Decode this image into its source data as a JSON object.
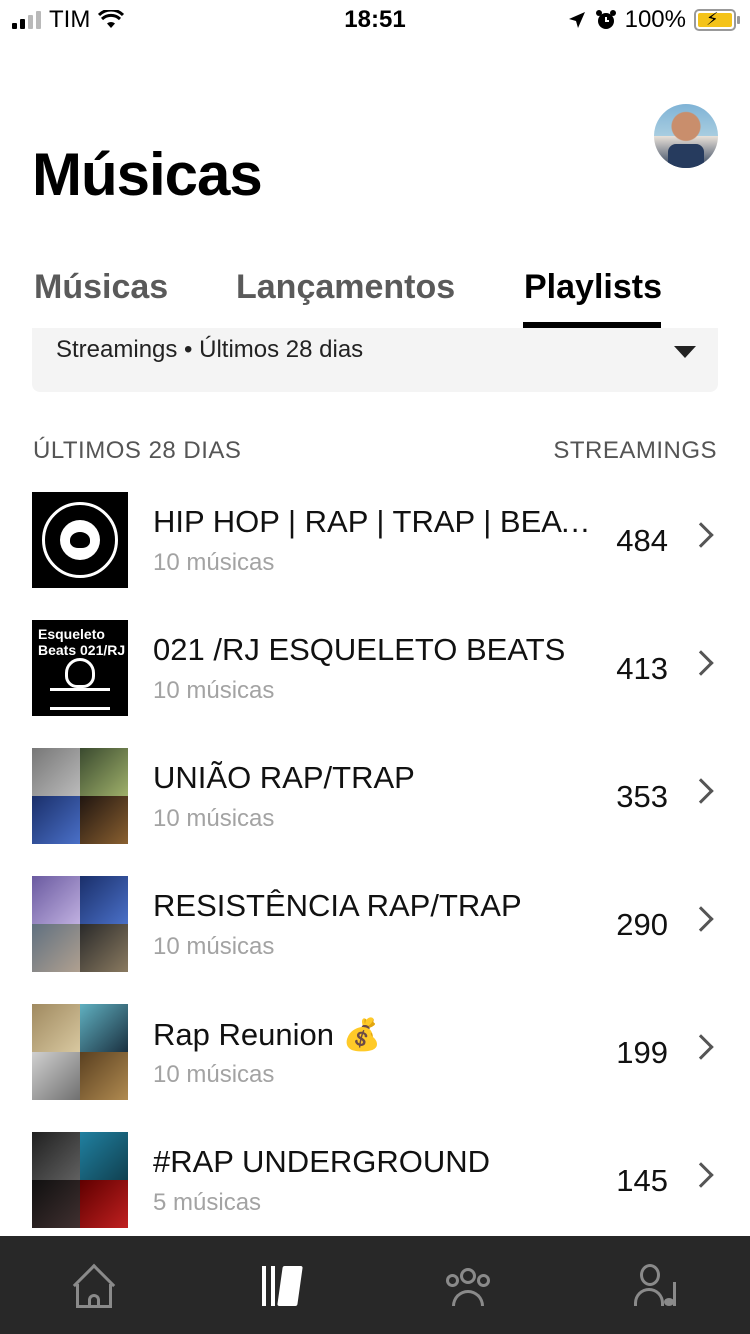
{
  "status_bar": {
    "carrier": "TIM",
    "time": "18:51",
    "battery": "100%"
  },
  "header": {
    "title": "Músicas"
  },
  "tabs": [
    {
      "label": "Músicas",
      "active": false
    },
    {
      "label": "Lançamentos",
      "active": false
    },
    {
      "label": "Playlists",
      "active": true
    }
  ],
  "filter": {
    "label": "Streamings • Últimos 28 dias"
  },
  "list": {
    "left_header": "ÚLTIMOS 28 DIAS",
    "right_header": "STREAMINGS",
    "rows": [
      {
        "title": "HIP HOP  |  RAP  |  TRAP  |  BEATS",
        "subtitle": "10 músicas",
        "count": "484"
      },
      {
        "title": "021 /RJ ESQUELETO BEATS",
        "subtitle": "10 músicas",
        "count": "413",
        "thumb_text": "Esqueleto Beats 021/RJ"
      },
      {
        "title": "UNIÃO RAP/TRAP",
        "subtitle": "10 músicas",
        "count": "353"
      },
      {
        "title": "RESISTÊNCIA RAP/TRAP",
        "subtitle": "10 músicas",
        "count": "290"
      },
      {
        "title": "Rap Reunion 💰",
        "subtitle": "10 músicas",
        "count": "199"
      },
      {
        "title": "#RAP UNDERGROUND",
        "subtitle": "5 músicas",
        "count": "145"
      }
    ]
  },
  "bottom_nav": [
    {
      "icon": "home-icon"
    },
    {
      "icon": "library-icon",
      "active": true
    },
    {
      "icon": "audience-icon"
    },
    {
      "icon": "profile-icon"
    }
  ],
  "colors": {
    "nav_background": "#282828",
    "filter_background": "#f4f4f4",
    "battery": "#f4c319"
  }
}
